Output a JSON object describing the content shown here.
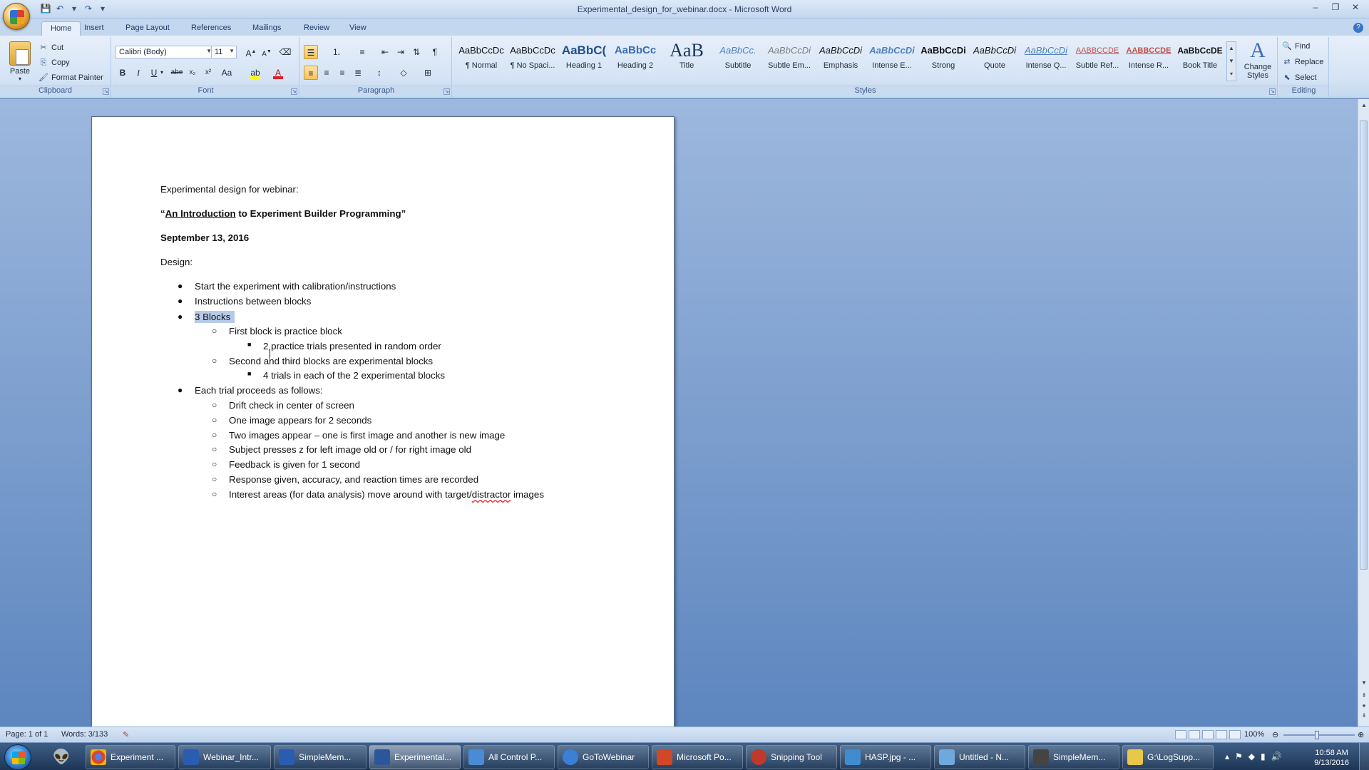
{
  "window": {
    "title": "Experimental_design_for_webinar.docx - Microsoft Word",
    "controls": [
      "–",
      "❐",
      "✕"
    ]
  },
  "quick_access": {
    "icons": [
      "save-icon",
      "undo-icon",
      "redo-icon",
      "customize-icon"
    ]
  },
  "ribbon": {
    "tabs": [
      "Home",
      "Insert",
      "Page Layout",
      "References",
      "Mailings",
      "Review",
      "View"
    ],
    "active_tab": "Home",
    "clipboard": {
      "paste": "Paste",
      "cut": "Cut",
      "copy": "Copy",
      "format_painter": "Format Painter",
      "label": "Clipboard"
    },
    "font": {
      "name": "Calibri (Body)",
      "size": "11",
      "label": "Font"
    },
    "paragraph": {
      "label": "Paragraph"
    },
    "styles": {
      "label": "Styles",
      "items": [
        {
          "preview": "AaBbCcDc",
          "name": "¶ Normal"
        },
        {
          "preview": "AaBbCcDc",
          "name": "¶ No Spaci..."
        },
        {
          "preview": "AaBbC(",
          "name": "Heading 1"
        },
        {
          "preview": "AaBbCc",
          "name": "Heading 2"
        },
        {
          "preview": "AaB",
          "name": "Title"
        },
        {
          "preview": "AaBbCc.",
          "name": "Subtitle"
        },
        {
          "preview": "AaBbCcDi",
          "name": "Subtle Em..."
        },
        {
          "preview": "AaBbCcDi",
          "name": "Emphasis"
        },
        {
          "preview": "AaBbCcDi",
          "name": "Intense E..."
        },
        {
          "preview": "AaBbCcDi",
          "name": "Strong"
        },
        {
          "preview": "AaBbCcDi",
          "name": "Quote"
        },
        {
          "preview": "AaBbCcDi",
          "name": "Intense Q..."
        },
        {
          "preview": "AABBCCDE",
          "name": "Subtle Ref..."
        },
        {
          "preview": "AABBCCDE",
          "name": "Intense R..."
        },
        {
          "preview": "AaBbCcDE",
          "name": "Book Title"
        }
      ],
      "change_styles": "Change Styles"
    },
    "editing": {
      "label": "Editing",
      "find": "Find",
      "replace": "Replace",
      "select": "Select"
    }
  },
  "document": {
    "line1": "Experimental design for webinar:",
    "line2_open": "“",
    "line2_underlined": "An Introduction",
    "line2_rest": " to Experiment Builder Programming”",
    "date": "September 13, 2016",
    "design": "Design:",
    "b1": "Start the experiment with calibration/instructions",
    "b2": "Instructions between blocks",
    "b3": "3 Blocks",
    "b3_1": "First block is practice block",
    "b3_1_1": "2 practice trials presented in random order",
    "b3_2": "Second and third blocks are experimental blocks",
    "b3_2_1": "4 trials in each of the 2 experimental blocks",
    "b4": "Each trial proceeds as follows:",
    "b4_items": [
      "Drift check in center of screen",
      "One image appears for 2 seconds",
      "Two images appear – one is first image and another is new image",
      "Subject presses z for left image old or / for right image old",
      "Feedback is given for 1 second",
      "Response given, accuracy, and reaction times are recorded"
    ],
    "b4_last_before": "Interest areas (for data analysis) move around with target/",
    "b4_last_misspelled": "distractor",
    "b4_last_after": " images"
  },
  "statusbar": {
    "page": "Page: 1 of 1",
    "words": "Words: 3/133",
    "zoom": "100%"
  },
  "taskbar": {
    "items": [
      {
        "label": "Experiment ...",
        "color": "#db4437"
      },
      {
        "label": "Webinar_Intr...",
        "color": "#2a5db0"
      },
      {
        "label": "SimpleMem...",
        "color": "#2a5db0"
      },
      {
        "label": "Experimental...",
        "color": "#2b579a"
      },
      {
        "label": "All Control P...",
        "color": "#4a8bd6"
      },
      {
        "label": "GoToWebinar",
        "color": "#3b7fd6"
      },
      {
        "label": "Microsoft Po...",
        "color": "#d24726"
      },
      {
        "label": "Snipping Tool",
        "color": "#c0392b"
      },
      {
        "label": "HASP.jpg - ...",
        "color": "#3f8ccf"
      },
      {
        "label": "Untitled - N...",
        "color": "#6fa8dc"
      },
      {
        "label": "SimpleMem...",
        "color": "#444"
      },
      {
        "label": "G:\\LogSupp...",
        "color": "#e8c84a"
      }
    ],
    "time": "10:58 AM",
    "date": "9/13/2016"
  }
}
